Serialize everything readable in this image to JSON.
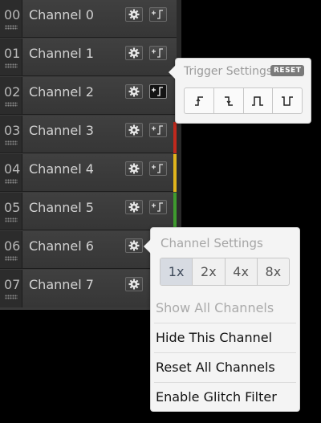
{
  "channels": [
    {
      "number": "00",
      "name": "Channel 0"
    },
    {
      "number": "01",
      "name": "Channel 1"
    },
    {
      "number": "02",
      "name": "Channel 2"
    },
    {
      "number": "03",
      "name": "Channel 3"
    },
    {
      "number": "04",
      "name": "Channel 4"
    },
    {
      "number": "05",
      "name": "Channel 5"
    },
    {
      "number": "06",
      "name": "Channel 6"
    },
    {
      "number": "07",
      "name": "Channel 7"
    }
  ],
  "channel_colors": {
    "3": "#c0291d",
    "4": "#e0b41c",
    "5": "#3e9a2e"
  },
  "trigger_popover": {
    "title": "Trigger Settings",
    "reset_label": "RESET",
    "options": [
      "rising-edge-icon",
      "falling-edge-icon",
      "high-pulse-icon",
      "low-pulse-icon"
    ]
  },
  "channel_popover": {
    "title": "Channel Settings",
    "multipliers": [
      "1x",
      "2x",
      "4x",
      "8x"
    ],
    "selected_multiplier": "1x",
    "menu": [
      {
        "label": "Show All Channels",
        "enabled": false
      },
      {
        "label": "Hide This Channel",
        "enabled": true
      },
      {
        "label": "Reset All Channels",
        "enabled": true
      },
      {
        "label": "Enable Glitch Filter",
        "enabled": true
      }
    ]
  }
}
